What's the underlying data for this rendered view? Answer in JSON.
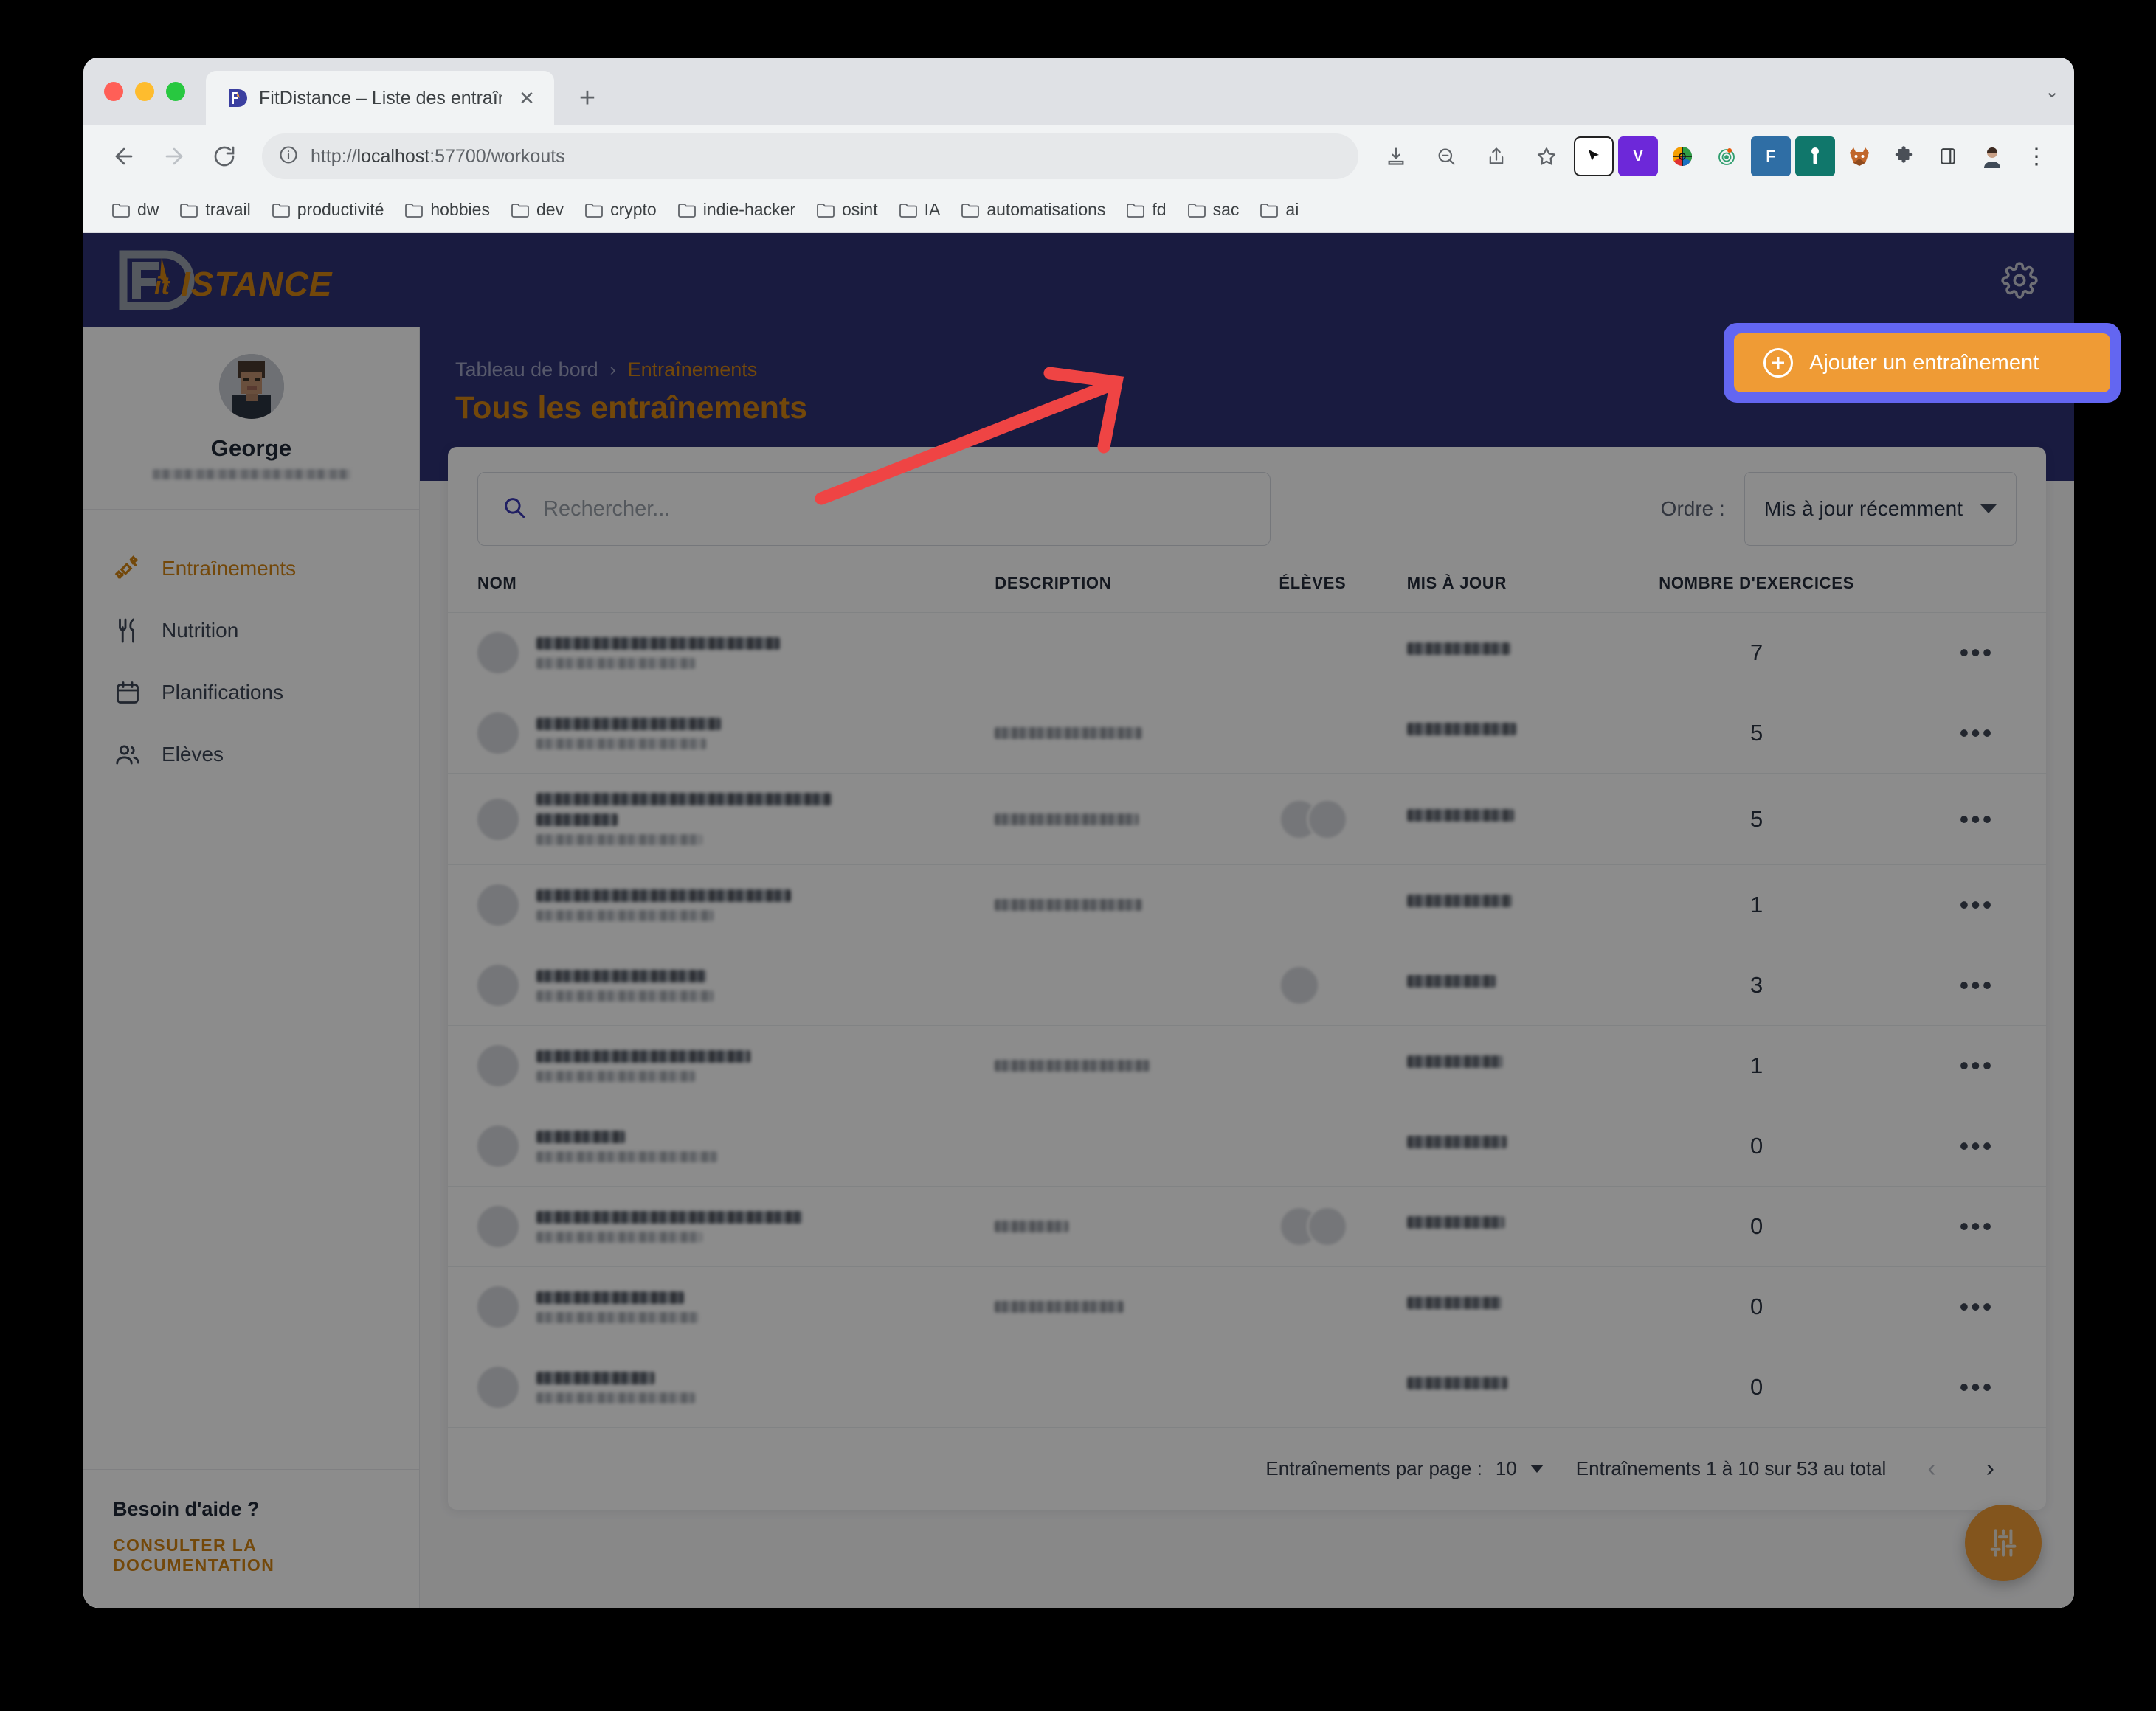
{
  "browser": {
    "tab": {
      "title": "FitDistance – Liste des entraîne",
      "close_label": "✕",
      "favicon_name": "fitdistance-favicon"
    },
    "new_tab_label": "+",
    "window_chevron_label": "⌄",
    "nav": {
      "back_label": "←",
      "forward_label": "→",
      "reload_label": "⟳"
    },
    "omnibox": {
      "info_icon": "ⓘ",
      "url_scheme": "http://",
      "url_host": "localhost",
      "url_rest": ":57700/workouts",
      "full_url": "http://localhost:57700/workouts"
    },
    "omnibox_actions": [
      "install-icon",
      "zoom-out-icon",
      "share-icon",
      "bookmark-star-icon"
    ],
    "extensions": [
      {
        "name": "cursor-extension-icon",
        "glyph": "➤",
        "bg": "#ffffff",
        "fg": "#111111"
      },
      {
        "name": "vimium-extension-icon",
        "glyph": "V",
        "bg": "#6d28d9",
        "fg": "#ffffff"
      },
      {
        "name": "colorpicker-extension-icon",
        "glyph": "✥",
        "bg": "#f0f0f0",
        "fg": "#333333"
      },
      {
        "name": "radar-extension-icon",
        "glyph": "◎",
        "bg": "#e8f7ef",
        "fg": "#2f9e6e"
      },
      {
        "name": "fitdistance-extension-icon",
        "glyph": "F",
        "bg": "#2f6ea5",
        "fg": "#ffffff"
      },
      {
        "name": "bitwarden-extension-icon",
        "glyph": "⌶",
        "bg": "#10776b",
        "fg": "#ffffff"
      },
      {
        "name": "firefox-relay-extension-icon",
        "glyph": "🦊",
        "bg": "transparent",
        "fg": "#c1662a"
      },
      {
        "name": "puzzle-extensions-icon",
        "glyph": "🧩",
        "bg": "transparent",
        "fg": "#4a4f57"
      },
      {
        "name": "sidepanel-icon",
        "glyph": "▯",
        "bg": "transparent",
        "fg": "#3c4043"
      },
      {
        "name": "profile-avatar-icon",
        "glyph": "👤",
        "bg": "transparent",
        "fg": "#3c4043"
      },
      {
        "name": "chrome-menu-icon",
        "glyph": "⋮",
        "bg": "transparent",
        "fg": "#3c4043"
      }
    ],
    "bookmarks": [
      {
        "label": "dw"
      },
      {
        "label": "travail"
      },
      {
        "label": "productivité"
      },
      {
        "label": "hobbies"
      },
      {
        "label": "dev"
      },
      {
        "label": "crypto"
      },
      {
        "label": "indie-hacker"
      },
      {
        "label": "osint"
      },
      {
        "label": "IA"
      },
      {
        "label": "automatisations"
      },
      {
        "label": "fd"
      },
      {
        "label": "sac"
      },
      {
        "label": "ai"
      }
    ]
  },
  "app": {
    "logo": {
      "brand_fit": "Fit",
      "brand_distance": "ISTANCE",
      "alt": "FitDistance"
    },
    "settings_icon_name": "gear-icon"
  },
  "sidebar": {
    "profile": {
      "name": "George",
      "email_redacted": true,
      "avatar_name": "user-avatar"
    },
    "nav": [
      {
        "label": "Entraînements",
        "icon": "dumbbell-icon",
        "active": true
      },
      {
        "label": "Nutrition",
        "icon": "cutlery-icon",
        "active": false
      },
      {
        "label": "Planifications",
        "icon": "calendar-icon",
        "active": false
      },
      {
        "label": "Elèves",
        "icon": "users-icon",
        "active": false
      }
    ],
    "help": {
      "title": "Besoin d'aide ?",
      "link": "CONSULTER LA DOCUMENTATION"
    }
  },
  "main": {
    "breadcrumb": {
      "parent": "Tableau de bord",
      "separator": "›",
      "current": "Entraînements"
    },
    "title": "Tous les entraînements",
    "add_button": {
      "label": "Ajouter un entraînement",
      "icon": "plus-circle-icon",
      "highlighted": true
    }
  },
  "toolbar": {
    "search": {
      "placeholder": "Rechercher...",
      "value": "",
      "icon": "search-icon"
    },
    "order": {
      "label": "Ordre :",
      "value": "Mis à jour récemment",
      "icon": "chevron-down-icon"
    }
  },
  "table": {
    "columns": [
      "NOM",
      "DESCRIPTION",
      "ÉLÈVES",
      "MIS À JOUR",
      "NOMBRE D'EXERCICES"
    ],
    "row_menu_label": "•••",
    "rows": [
      {
        "name_redacted": true,
        "name_width": 330,
        "sub_width": 215,
        "has_desc": false,
        "desc_width": 0,
        "eleves": 0,
        "updated_redacted": true,
        "updated_width": 140,
        "exercises": "7",
        "two_line_title": false
      },
      {
        "name_redacted": true,
        "name_width": 250,
        "sub_width": 230,
        "has_desc": true,
        "desc_width": 200,
        "eleves": 0,
        "updated_redacted": true,
        "updated_width": 148,
        "exercises": "5",
        "two_line_title": false
      },
      {
        "name_redacted": true,
        "name_width": 400,
        "sub_width": 225,
        "has_desc": true,
        "desc_width": 195,
        "eleves": 2,
        "updated_redacted": true,
        "updated_width": 145,
        "exercises": "5",
        "two_line_title": true
      },
      {
        "name_redacted": true,
        "name_width": 345,
        "sub_width": 240,
        "has_desc": true,
        "desc_width": 200,
        "eleves": 0,
        "updated_redacted": true,
        "updated_width": 142,
        "exercises": "1",
        "two_line_title": false
      },
      {
        "name_redacted": true,
        "name_width": 230,
        "sub_width": 240,
        "has_desc": false,
        "desc_width": 0,
        "eleves": 1,
        "updated_redacted": true,
        "updated_width": 120,
        "exercises": "3",
        "two_line_title": false
      },
      {
        "name_redacted": true,
        "name_width": 290,
        "sub_width": 215,
        "has_desc": true,
        "desc_width": 210,
        "eleves": 0,
        "updated_redacted": true,
        "updated_width": 130,
        "exercises": "1",
        "two_line_title": false
      },
      {
        "name_redacted": true,
        "name_width": 120,
        "sub_width": 245,
        "has_desc": false,
        "desc_width": 0,
        "eleves": 0,
        "updated_redacted": true,
        "updated_width": 135,
        "exercises": "0",
        "two_line_title": false
      },
      {
        "name_redacted": true,
        "name_width": 360,
        "sub_width": 225,
        "has_desc": true,
        "desc_width": 100,
        "eleves": 2,
        "updated_redacted": true,
        "updated_width": 132,
        "exercises": "0",
        "two_line_title": false
      },
      {
        "name_redacted": true,
        "name_width": 200,
        "sub_width": 220,
        "has_desc": true,
        "desc_width": 175,
        "eleves": 0,
        "updated_redacted": true,
        "updated_width": 128,
        "exercises": "0",
        "two_line_title": false
      },
      {
        "name_redacted": true,
        "name_width": 160,
        "sub_width": 215,
        "has_desc": false,
        "desc_width": 0,
        "eleves": 0,
        "updated_redacted": true,
        "updated_width": 136,
        "exercises": "0",
        "two_line_title": false
      }
    ]
  },
  "pagination": {
    "per_page_label": "Entraînements par page :",
    "per_page_value": "10",
    "range_text": "Entraînements 1 à 10 sur 53 au total",
    "prev_label": "‹",
    "next_label": "›"
  },
  "fab": {
    "icon": "sliders-icon",
    "name": "filters-fab"
  },
  "annotation": {
    "arrow_color": "#ef4444",
    "points_to": "Ajouter un entraînement"
  },
  "colors": {
    "brand_navy": "#2e3275",
    "brand_orange": "#d28413",
    "accent_orange": "#ef9b35",
    "highlight_ring": "#6366f1",
    "arrow_red": "#ef4444"
  }
}
